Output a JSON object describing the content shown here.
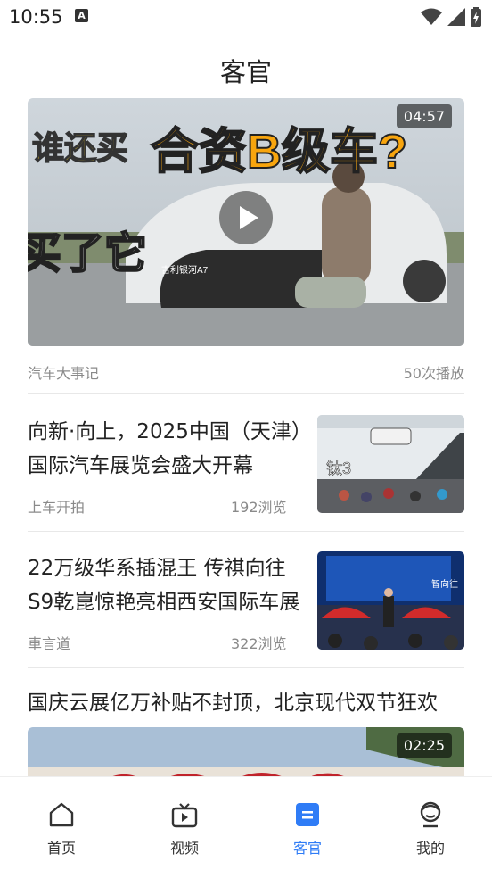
{
  "status_bar": {
    "time": "10:55",
    "notification": "A"
  },
  "page": {
    "title": "客官"
  },
  "feed": {
    "video1": {
      "duration": "04:57",
      "source": "汽车大事记",
      "plays": "50次播放",
      "thumb_text_top_a": "谁还买",
      "thumb_text_top_b": "合资B级车?",
      "thumb_text_left": "买了它",
      "plate": "吉利银河A7"
    },
    "articles": [
      {
        "title": "向新·向上，2025中国（天津）国际汽车展览会盛大开幕",
        "source": "上车开拍",
        "views": "192浏览",
        "thumb_text": "钛3"
      },
      {
        "title": "22万级华系插混王 传祺向往S9乾崑惊艳亮相西安国际车展",
        "source": "車言道",
        "views": "322浏览",
        "thumb_text": "智向往"
      }
    ],
    "article3": {
      "title": "国庆云展亿万补贴不封顶，北京现代双节狂欢"
    },
    "video2": {
      "duration": "02:25"
    }
  },
  "tabs": [
    {
      "label": "首页",
      "icon": "home-icon"
    },
    {
      "label": "视频",
      "icon": "video-tv-icon"
    },
    {
      "label": "客官",
      "icon": "document-icon",
      "active": true
    },
    {
      "label": "我的",
      "icon": "user-icon"
    }
  ],
  "colors": {
    "accent": "#2f7cf6"
  }
}
